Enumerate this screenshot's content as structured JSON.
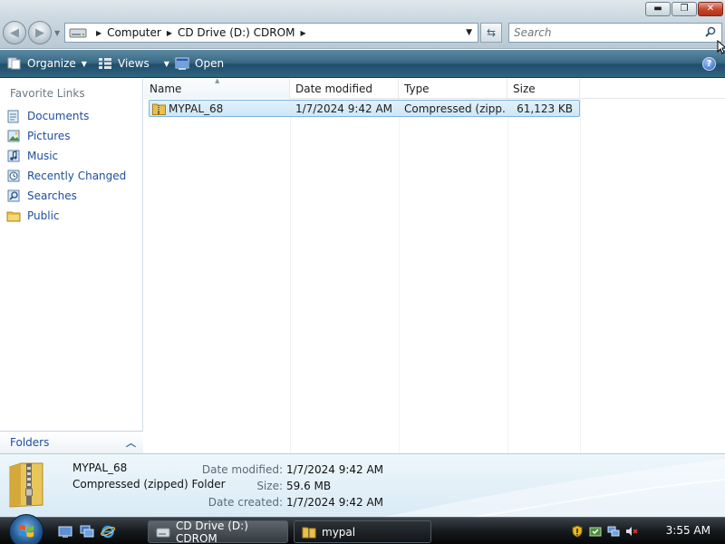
{
  "window": {
    "minimize_glyph": "▬",
    "maximize_glyph": "❐",
    "close_glyph": "✕"
  },
  "address_bar": {
    "crumbs": [
      "Computer",
      "CD Drive (D:) CDROM"
    ],
    "drive_icon": "cd-drive-icon"
  },
  "search": {
    "placeholder": "Search",
    "icon": "search-icon"
  },
  "command_bar": {
    "organize_label": "Organize",
    "views_label": "Views",
    "open_label": "Open",
    "help_glyph": "?"
  },
  "nav_pane": {
    "heading": "Favorite Links",
    "items": [
      {
        "label": "Documents",
        "icon": "documents-icon"
      },
      {
        "label": "Pictures",
        "icon": "pictures-icon"
      },
      {
        "label": "Music",
        "icon": "music-icon"
      },
      {
        "label": "Recently Changed",
        "icon": "recently-changed-icon"
      },
      {
        "label": "Searches",
        "icon": "searches-icon"
      },
      {
        "label": "Public",
        "icon": "public-folder-icon"
      }
    ],
    "folders_label": "Folders"
  },
  "file_list": {
    "columns": [
      "Name",
      "Date modified",
      "Type",
      "Size"
    ],
    "rows": [
      {
        "name": "MYPAL_68",
        "date_modified": "1/7/2024 9:42 AM",
        "type": "Compressed (zipp...",
        "size": "61,123 KB",
        "icon": "zip-folder-icon",
        "selected": true
      }
    ]
  },
  "details_pane": {
    "name": "MYPAL_68",
    "kind": "Compressed (zipped) Folder",
    "labels": [
      "Date modified:",
      "Size:",
      "Date created:"
    ],
    "values": [
      "1/7/2024 9:42 AM",
      "59.6 MB",
      "1/7/2024 9:42 AM"
    ]
  },
  "taskbar": {
    "tasks": [
      {
        "label": "CD Drive (D:) CDROM",
        "active": true,
        "icon": "cd-drive-icon"
      },
      {
        "label": "mypal",
        "active": false,
        "icon": "folder-icon"
      }
    ],
    "clock": "3:55 AM"
  },
  "colors": {
    "link_blue": "#1f4fa0",
    "command_bar": "#2f6581",
    "selection": "#cde6f7"
  }
}
